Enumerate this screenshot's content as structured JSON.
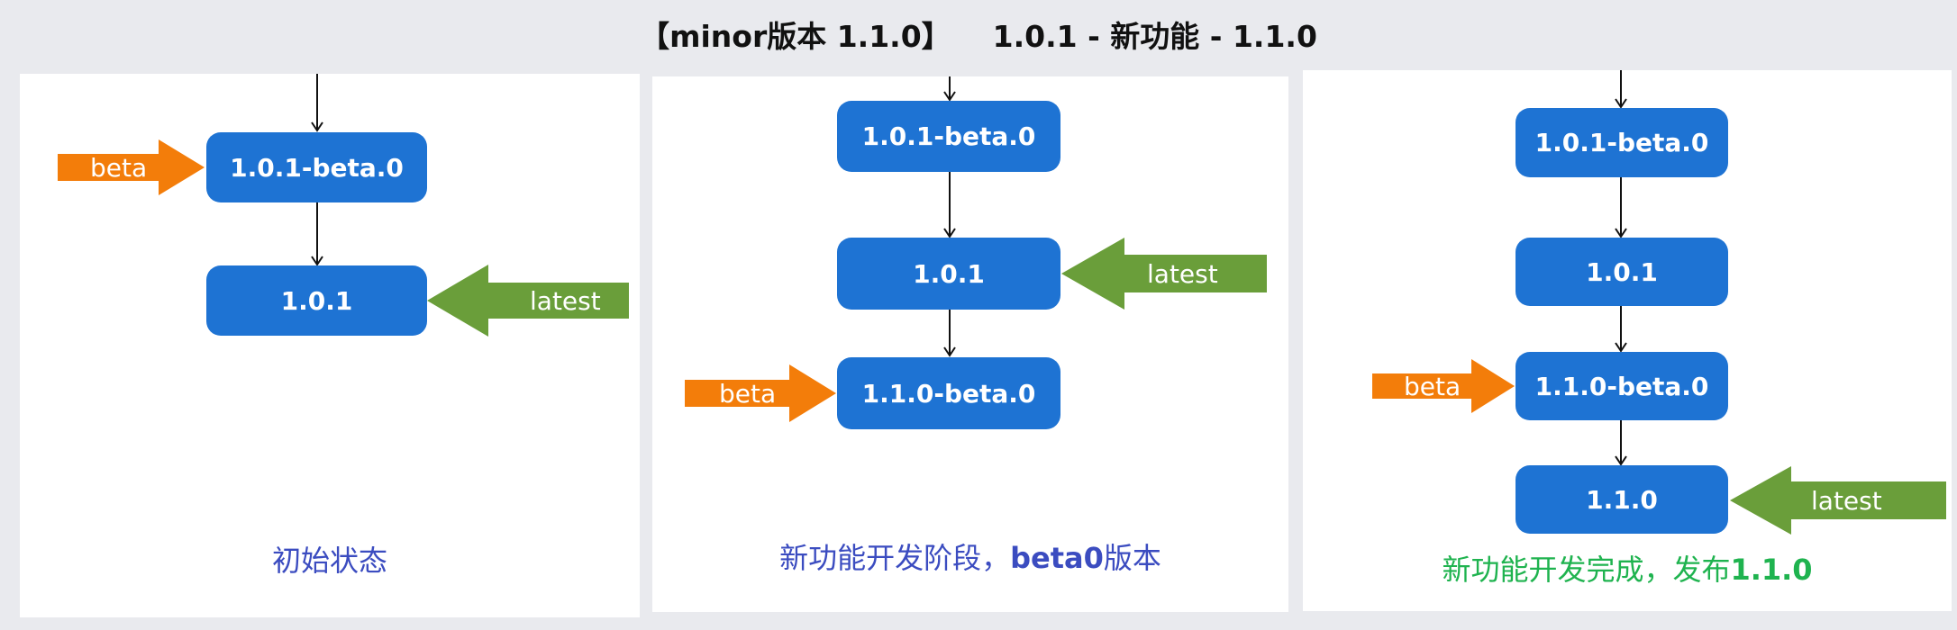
{
  "title": {
    "part1": "【minor版本 1.1.0】",
    "part2": "1.0.1 - 新功能 - 1.1.0"
  },
  "colors": {
    "version_box": "#1e73d3",
    "beta_arrow": "#f37d0a",
    "latest_arrow": "#6a9e3a",
    "caption_blue": "#3b4cc0",
    "caption_green": "#1fb34f"
  },
  "panels": [
    {
      "boxes": [
        "1.0.1-beta.0",
        "1.0.1"
      ],
      "beta_label": "beta",
      "latest_label": "latest",
      "caption": "初始状态"
    },
    {
      "boxes": [
        "1.0.1-beta.0",
        "1.0.1",
        "1.1.0-beta.0"
      ],
      "beta_label": "beta",
      "latest_label": "latest",
      "caption_prefix": "新功能开发阶段，",
      "caption_bold": "beta0",
      "caption_suffix": "版本"
    },
    {
      "boxes": [
        "1.0.1-beta.0",
        "1.0.1",
        "1.1.0-beta.0",
        "1.1.0"
      ],
      "beta_label": "beta",
      "latest_label": "latest",
      "caption_prefix": "新功能开发完成，发布",
      "caption_bold": "1.1.0"
    }
  ]
}
